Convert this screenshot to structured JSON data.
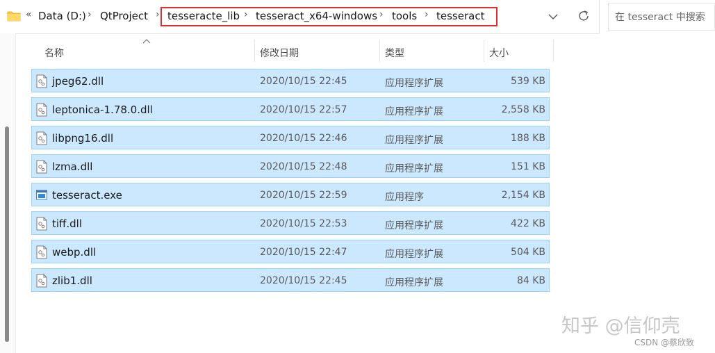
{
  "address_bar": {
    "overflow_glyph": "«",
    "separator": "›",
    "crumbs": [
      "Data (D:)",
      "QtProject",
      "tesseracte_lib",
      "tesseract_x64-windows",
      "tools",
      "tesseract"
    ],
    "highlight_color": "#d9322f"
  },
  "search": {
    "placeholder": "在 tesseract 中搜索"
  },
  "columns": {
    "name": "名称",
    "date": "修改日期",
    "type": "类型",
    "size": "大小"
  },
  "files": [
    {
      "name": "jpeg62.dll",
      "date": "2020/10/15 22:45",
      "type": "应用程序扩展",
      "size": "539 KB",
      "icon": "dll-file-icon"
    },
    {
      "name": "leptonica-1.78.0.dll",
      "date": "2020/10/15 22:57",
      "type": "应用程序扩展",
      "size": "2,558 KB",
      "icon": "dll-file-icon"
    },
    {
      "name": "libpng16.dll",
      "date": "2020/10/15 22:46",
      "type": "应用程序扩展",
      "size": "188 KB",
      "icon": "dll-file-icon"
    },
    {
      "name": "lzma.dll",
      "date": "2020/10/15 22:48",
      "type": "应用程序扩展",
      "size": "151 KB",
      "icon": "dll-file-icon"
    },
    {
      "name": "tesseract.exe",
      "date": "2020/10/15 22:59",
      "type": "应用程序",
      "size": "2,154 KB",
      "icon": "exe-file-icon"
    },
    {
      "name": "tiff.dll",
      "date": "2020/10/15 22:53",
      "type": "应用程序扩展",
      "size": "422 KB",
      "icon": "dll-file-icon"
    },
    {
      "name": "webp.dll",
      "date": "2020/10/15 22:47",
      "type": "应用程序扩展",
      "size": "504 KB",
      "icon": "dll-file-icon"
    },
    {
      "name": "zlib1.dll",
      "date": "2020/10/15 22:45",
      "type": "应用程序扩展",
      "size": "84 KB",
      "icon": "dll-file-icon"
    }
  ],
  "colors": {
    "selection_fill": "#cce8ff",
    "selection_border": "#99d1ff",
    "folder_yellow": "#ffc83d"
  },
  "watermark": {
    "main": "知乎 @信仰壳",
    "sub": "CSDN @蔡欣致"
  }
}
